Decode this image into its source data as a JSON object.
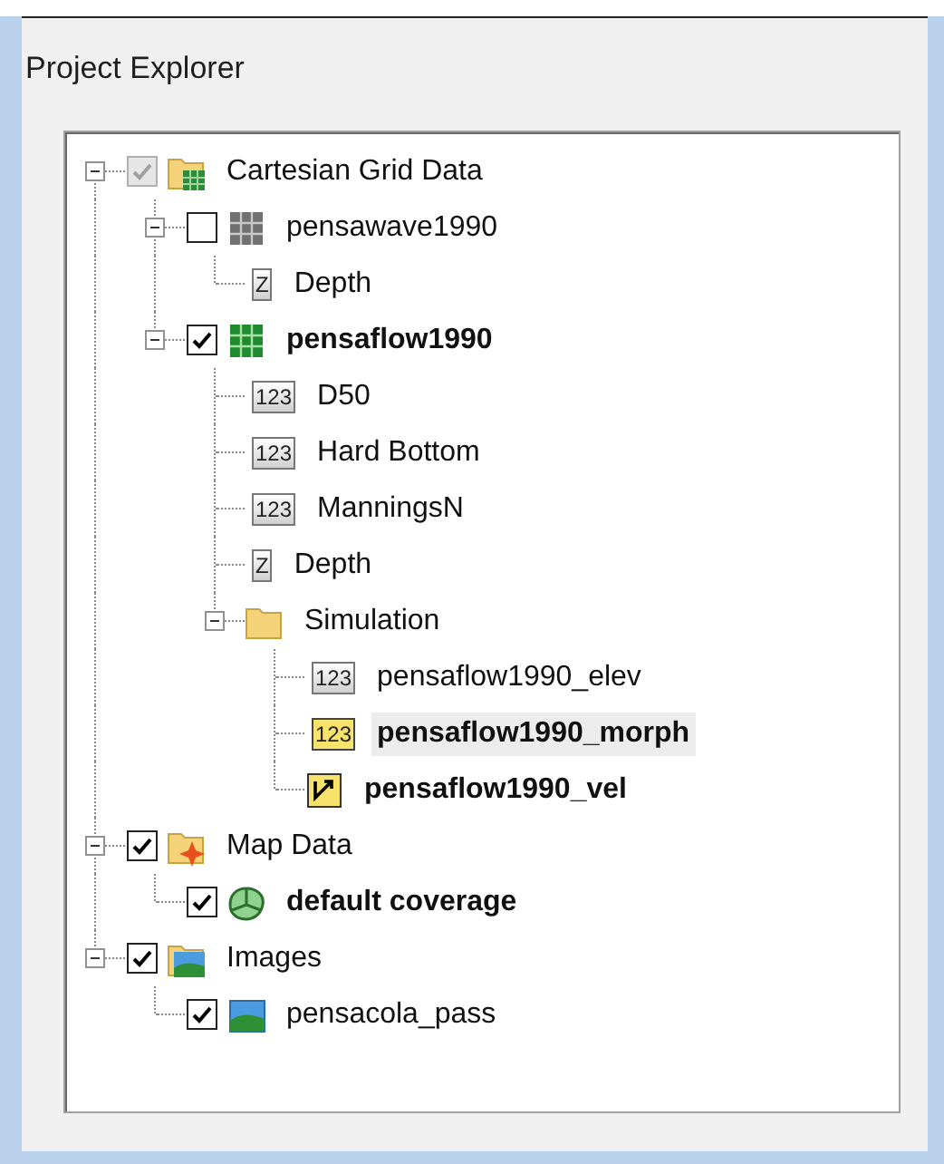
{
  "panel": {
    "title": "Project Explorer"
  },
  "tree": [
    {
      "label": "Cartesian Grid Data",
      "kind": "gridfolder",
      "checked": true,
      "disabled": true,
      "bold": false,
      "selected": false,
      "expanded": true,
      "children": [
        {
          "label": "pensawave1990",
          "kind": "grid",
          "checked": false,
          "disabled": false,
          "bold": false,
          "selected": false,
          "expanded": true,
          "children": [
            {
              "label": "Depth",
              "kind": "dataset",
              "icon_text": "Z",
              "bold": false,
              "selected": false
            }
          ]
        },
        {
          "label": "pensaflow1990",
          "kind": "greengrid",
          "checked": true,
          "disabled": false,
          "bold": true,
          "selected": false,
          "expanded": true,
          "children": [
            {
              "label": "D50",
              "kind": "dataset",
              "icon_text": "123",
              "bold": false,
              "selected": false
            },
            {
              "label": "Hard Bottom",
              "kind": "dataset",
              "icon_text": "123",
              "bold": false,
              "selected": false
            },
            {
              "label": "ManningsN",
              "kind": "dataset",
              "icon_text": "123",
              "bold": false,
              "selected": false
            },
            {
              "label": "Depth",
              "kind": "dataset",
              "icon_text": "Z",
              "bold": false,
              "selected": false
            },
            {
              "label": "Simulation",
              "kind": "folder",
              "bold": false,
              "selected": false,
              "expanded": true,
              "children": [
                {
                  "label": "pensaflow1990_elev",
                  "kind": "dataset",
                  "icon_text": "123",
                  "bold": false,
                  "selected": false
                },
                {
                  "label": "pensaflow1990_morph",
                  "kind": "activedataset",
                  "icon_text": "123",
                  "bold": true,
                  "selected": true
                },
                {
                  "label": "pensaflow1990_vel",
                  "kind": "vector",
                  "bold": true,
                  "selected": false
                }
              ]
            }
          ]
        }
      ]
    },
    {
      "label": "Map Data",
      "kind": "mapfolder",
      "checked": true,
      "disabled": false,
      "bold": false,
      "selected": false,
      "expanded": true,
      "children": [
        {
          "label": "default coverage",
          "kind": "coverage",
          "checked": true,
          "disabled": false,
          "bold": true,
          "selected": false
        }
      ]
    },
    {
      "label": "Images",
      "kind": "imagefolder",
      "checked": true,
      "disabled": false,
      "bold": false,
      "selected": false,
      "expanded": true,
      "children": [
        {
          "label": "pensacola_pass",
          "kind": "image",
          "checked": true,
          "disabled": false,
          "bold": false,
          "selected": false
        }
      ]
    }
  ]
}
